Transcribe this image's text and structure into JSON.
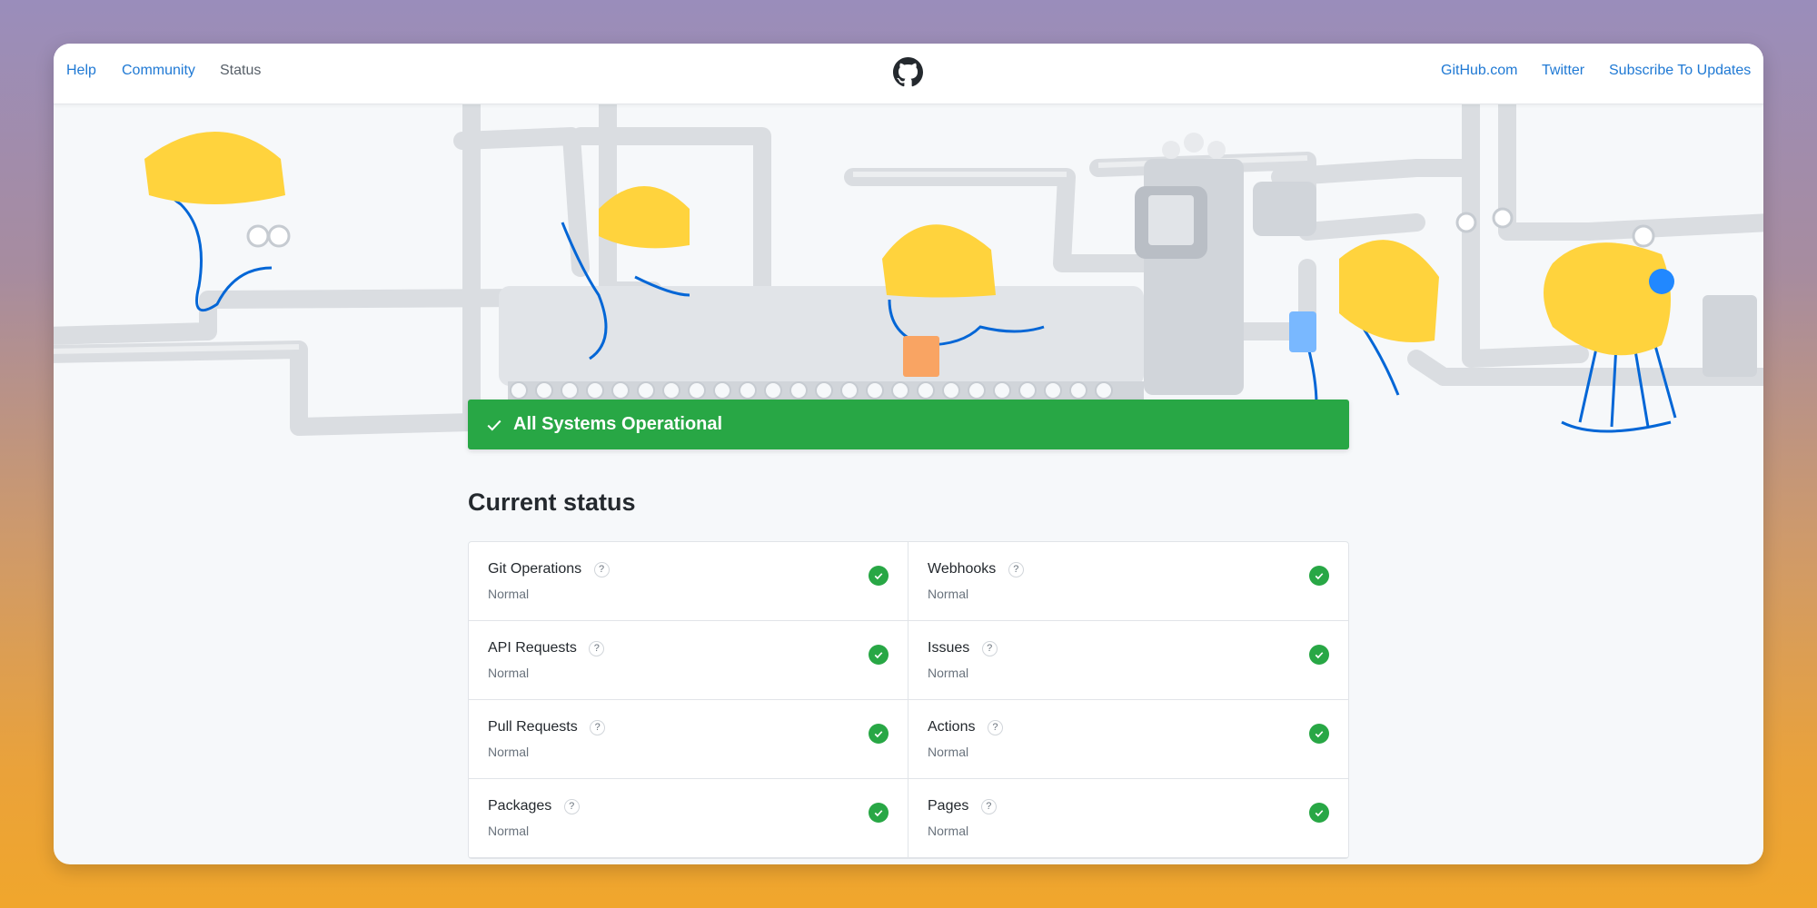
{
  "nav": {
    "left": [
      {
        "label": "Help"
      },
      {
        "label": "Community"
      },
      {
        "label": "Status"
      }
    ],
    "logo": "github-octocat-icon",
    "right": [
      {
        "label": "GitHub.com"
      },
      {
        "label": "Twitter"
      },
      {
        "label": "Subscribe To Updates"
      }
    ]
  },
  "banner": {
    "label": "All Systems Operational",
    "color": "#28a745"
  },
  "section_title": "Current status",
  "components": [
    {
      "name": "Git Operations",
      "status": "Normal"
    },
    {
      "name": "Webhooks",
      "status": "Normal"
    },
    {
      "name": "API Requests",
      "status": "Normal"
    },
    {
      "name": "Issues",
      "status": "Normal"
    },
    {
      "name": "Pull Requests",
      "status": "Normal"
    },
    {
      "name": "Actions",
      "status": "Normal"
    },
    {
      "name": "Packages",
      "status": "Normal"
    },
    {
      "name": "Pages",
      "status": "Normal"
    }
  ],
  "help_glyph": "?",
  "colors": {
    "link": "#1f79d4",
    "ok": "#28a745",
    "helmet": "#ffd33d",
    "octocat_line": "#0366d6"
  }
}
